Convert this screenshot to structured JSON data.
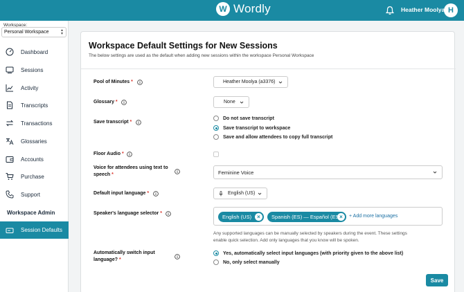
{
  "header": {
    "logo_mark": "W",
    "logo_text": "Wordly",
    "user_name": "Heather Moolya",
    "avatar_initial": "H"
  },
  "sidebar": {
    "workspace_label": "Workspace:",
    "workspace_value": "Personal Workspace",
    "items": [
      {
        "label": "Dashboard",
        "icon": "dashboard-icon"
      },
      {
        "label": "Sessions",
        "icon": "monitor-icon"
      },
      {
        "label": "Activity",
        "icon": "chart-line-icon"
      },
      {
        "label": "Transcripts",
        "icon": "document-icon"
      },
      {
        "label": "Transactions",
        "icon": "arrows-swap-icon"
      },
      {
        "label": "Glossaries",
        "icon": "translate-icon"
      },
      {
        "label": "Accounts",
        "icon": "wallet-icon"
      },
      {
        "label": "Purchase",
        "icon": "cart-icon"
      },
      {
        "label": "Support",
        "icon": "phone-icon"
      }
    ],
    "section_label": "Workspace Admin",
    "active_item": {
      "label": "Session Defaults",
      "icon": "session-defaults-icon"
    }
  },
  "main": {
    "title": "Workspace Default Settings for New Sessions",
    "description": "The below settings are used as the default when adding new sessions within the workspace Personal Workspace",
    "pool_of_minutes": {
      "label": "Pool of Minutes",
      "req": "*",
      "value": "Heather Moolya (a3376)"
    },
    "glossary": {
      "label": "Glossary",
      "req": "*",
      "value": "None"
    },
    "save_transcript": {
      "label": "Save transcript",
      "req": "*",
      "options": [
        "Do not save transcript",
        "Save transcript to workspace",
        "Save and allow attendees to copy full transcript"
      ],
      "selected": 1
    },
    "floor_audio": {
      "label": "Floor Audio",
      "req": "*",
      "checked": false
    },
    "voice": {
      "label_line1": "Voice for attendees using text to",
      "label_line2": "speech",
      "req": "*",
      "value": "Feminine Voice"
    },
    "input_language": {
      "label": "Default input language",
      "req": "*",
      "value": "English (US)"
    },
    "speaker_selector": {
      "label": "Speaker's language selector",
      "req": "*",
      "chips": [
        "English (US)",
        "Spanish (ES) — Español (ES)"
      ],
      "add_link": "+ Add more languages",
      "helper_line1": "Any supported languages can be manually selected by speakers during the event. These settings",
      "helper_line2": "enable quick selection. Add only languages that you know will be spoken."
    },
    "auto_switch": {
      "label_line1": "Automatically switch input",
      "label_line2": "language?",
      "req": "*",
      "options": [
        "Yes, automatically select input languages (with priority given to the above list)",
        "No, only select manually"
      ],
      "selected": 0
    },
    "save_label": "Save"
  },
  "colors": {
    "brand": "#1a8aa3",
    "required": "#d9342b"
  }
}
